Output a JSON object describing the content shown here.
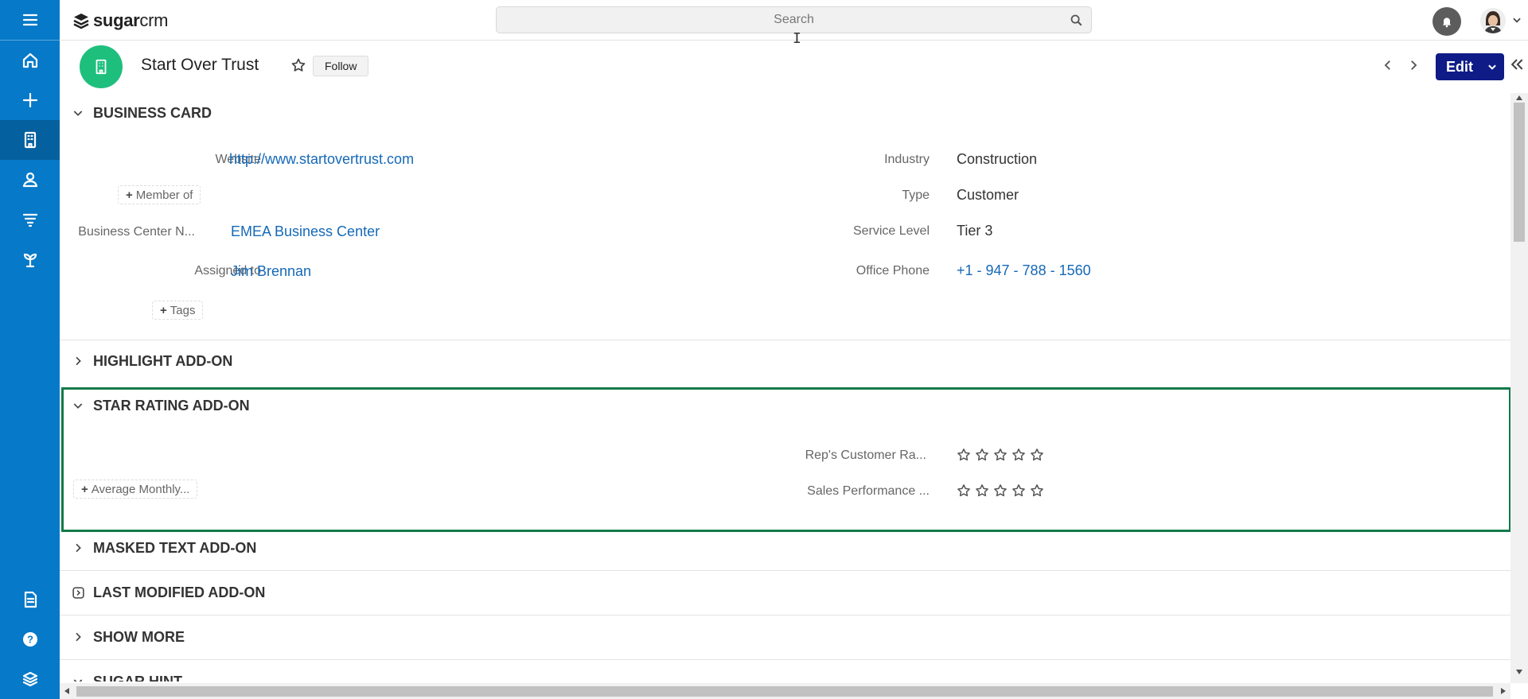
{
  "app": {
    "logo_bold": "sugar",
    "logo_light": "crm",
    "search_placeholder": "Search"
  },
  "record": {
    "title": "Start Over Trust",
    "follow_label": "Follow",
    "edit_label": "Edit"
  },
  "business_card": {
    "title": "BUSINESS CARD",
    "website_label": "Website",
    "website_value": "http://www.startovertrust.com",
    "member_of_label": "Member of",
    "business_center_label": "Business Center N...",
    "business_center_value": "EMEA Business Center",
    "assigned_label": "Assigned to",
    "assigned_value": "Jim Brennan",
    "tags_label": "Tags",
    "industry_label": "Industry",
    "industry_value": "Construction",
    "type_label": "Type",
    "type_value": "Customer",
    "service_level_label": "Service Level",
    "service_level_value": "Tier 3",
    "office_phone_label": "Office Phone",
    "office_phone_value": "+1 - 947 - 788 - 1560"
  },
  "panels": {
    "highlight": "HIGHLIGHT ADD-ON",
    "star_rating": "STAR RATING ADD-ON",
    "masked_text": "MASKED TEXT ADD-ON",
    "last_modified": "LAST MODIFIED ADD-ON",
    "show_more": "SHOW MORE",
    "sugar_hint": "SUGAR HINT"
  },
  "star_rating": {
    "reps_rating_label": "Rep's Customer Ra...",
    "reps_rating_value": 0,
    "sales_perf_label": "Sales Performance ...",
    "sales_perf_value": 0,
    "max_stars": 5,
    "avg_monthly_label": "Average Monthly..."
  },
  "colors": {
    "nav_bg": "#0679c8",
    "record_icon": "#1ebf7d",
    "edit_button": "#0f1b86",
    "link": "#1569b7",
    "focus_border": "#137a4a"
  }
}
